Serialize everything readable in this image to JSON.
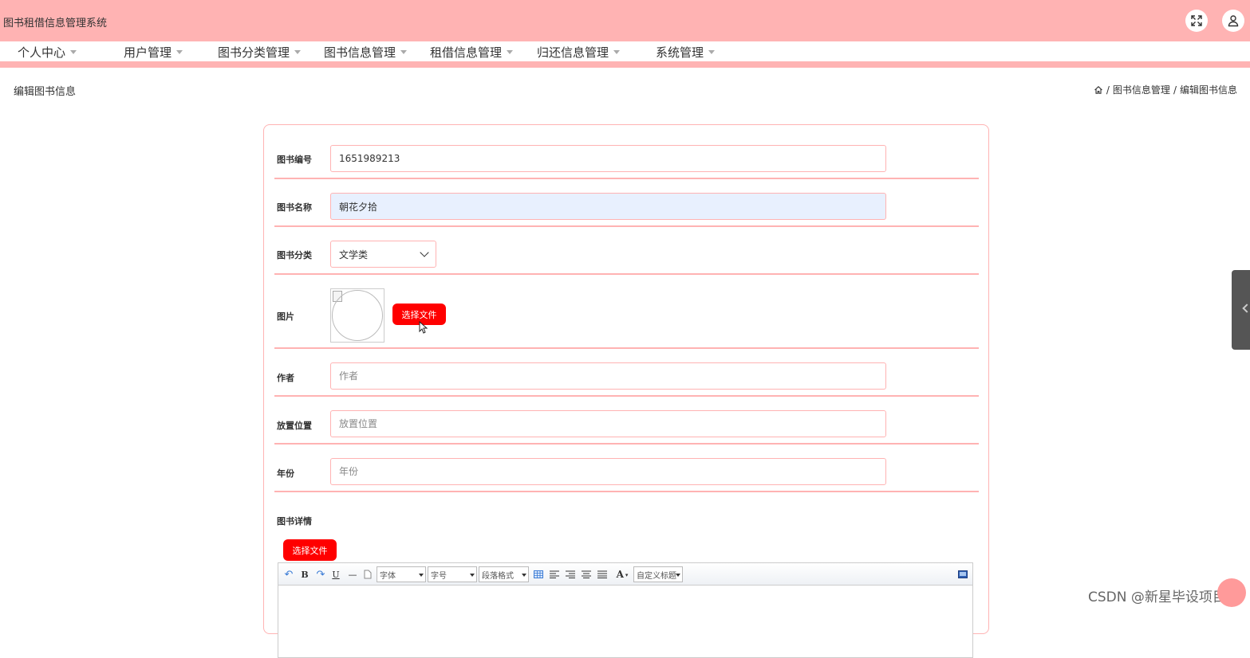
{
  "header": {
    "app_title": "图书租借信息管理系统",
    "icons": [
      "fullscreen-icon",
      "user-icon"
    ]
  },
  "menu": {
    "items": [
      {
        "label": "个人中心"
      },
      {
        "label": "用户管理"
      },
      {
        "label": "图书分类管理"
      },
      {
        "label": "图书信息管理"
      },
      {
        "label": "租借信息管理"
      },
      {
        "label": "归还信息管理"
      },
      {
        "label": "系统管理"
      }
    ]
  },
  "page": {
    "title": "编辑图书信息",
    "breadcrumb": [
      "图书信息管理",
      "编辑图书信息"
    ]
  },
  "form": {
    "book_no": {
      "label": "图书编号",
      "value": "1651989213"
    },
    "book_name": {
      "label": "图书名称",
      "value": "朝花夕拾"
    },
    "category": {
      "label": "图书分类",
      "value": "文学类"
    },
    "image": {
      "label": "图片",
      "button": "选择文件"
    },
    "author": {
      "label": "作者",
      "placeholder": "作者"
    },
    "location": {
      "label": "放置位置",
      "placeholder": "放置位置"
    },
    "year": {
      "label": "年份",
      "placeholder": "年份"
    },
    "details": {
      "label": "图书详情",
      "button": "选择文件"
    }
  },
  "editor": {
    "font_family": "字体",
    "font_size": "字号",
    "paragraph": "段落格式",
    "custom_title": "自定义标题",
    "font_color_glyph": "A",
    "bold": "B",
    "underline": "U"
  },
  "watermark": "CSDN @新星毕设项目"
}
